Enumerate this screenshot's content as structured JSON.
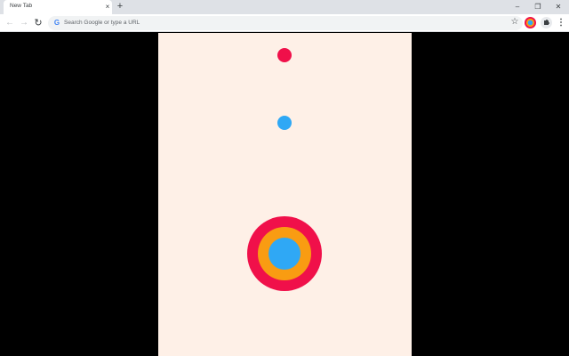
{
  "browser": {
    "tab": {
      "title": "New Tab",
      "close_glyph": "×"
    },
    "new_tab_glyph": "+",
    "window_controls": {
      "minimize": "–",
      "restore": "❐",
      "close": "✕"
    },
    "toolbar": {
      "back_glyph": "←",
      "forward_glyph": "→",
      "reload_glyph": "↻",
      "omnibox_placeholder": "Search Google or type a URL",
      "google_icon_glyph": "G",
      "star_glyph": "☆",
      "menu_glyph": "⋮"
    }
  },
  "game": {
    "colors": {
      "background": "#fef0e7",
      "red": "#f0104a",
      "blue": "#2fa8f5",
      "orange": "#f99c12"
    },
    "falling_balls": [
      {
        "name": "red-ball",
        "color": "#f0104a"
      },
      {
        "name": "blue-ball",
        "color": "#2fa8f5"
      }
    ],
    "target_rings": [
      "#f0104a",
      "#f99c12",
      "#2fa8f5"
    ]
  }
}
